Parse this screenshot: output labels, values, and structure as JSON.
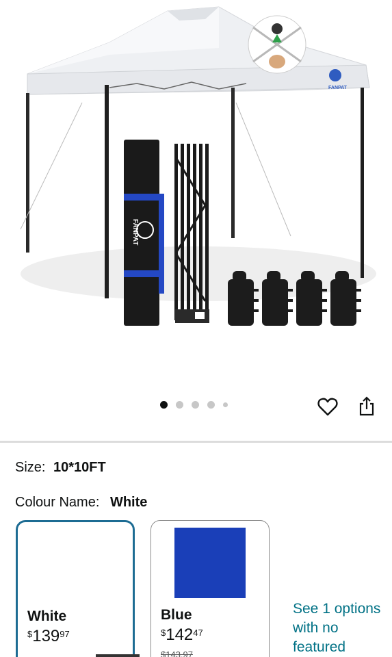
{
  "image": {
    "brand_badge_text": "FANPAT",
    "bag_text": "FANPAT",
    "carousel": {
      "count": 5,
      "active_index": 0
    }
  },
  "actions": {
    "favorite_icon": "heart-outline",
    "share_icon": "share-up-arrow"
  },
  "size": {
    "label": "Size:",
    "value": "10*10FT"
  },
  "colour": {
    "label": "Colour Name:",
    "value": "White"
  },
  "swatches": [
    {
      "name": "White",
      "price_symbol": "$",
      "price_whole": "139",
      "price_fraction": "97",
      "selected": true,
      "color": "#ffffff"
    },
    {
      "name": "Blue",
      "price_symbol": "$",
      "price_whole": "142",
      "price_fraction": "47",
      "strike_price": "$143.97",
      "selected": false,
      "color": "#1a3fb8"
    }
  ],
  "see_options": "See 1 options with no featured",
  "colors": {
    "accent_border": "#1d6c93",
    "link": "#007185",
    "blue_swatch": "#1a3fb8"
  }
}
